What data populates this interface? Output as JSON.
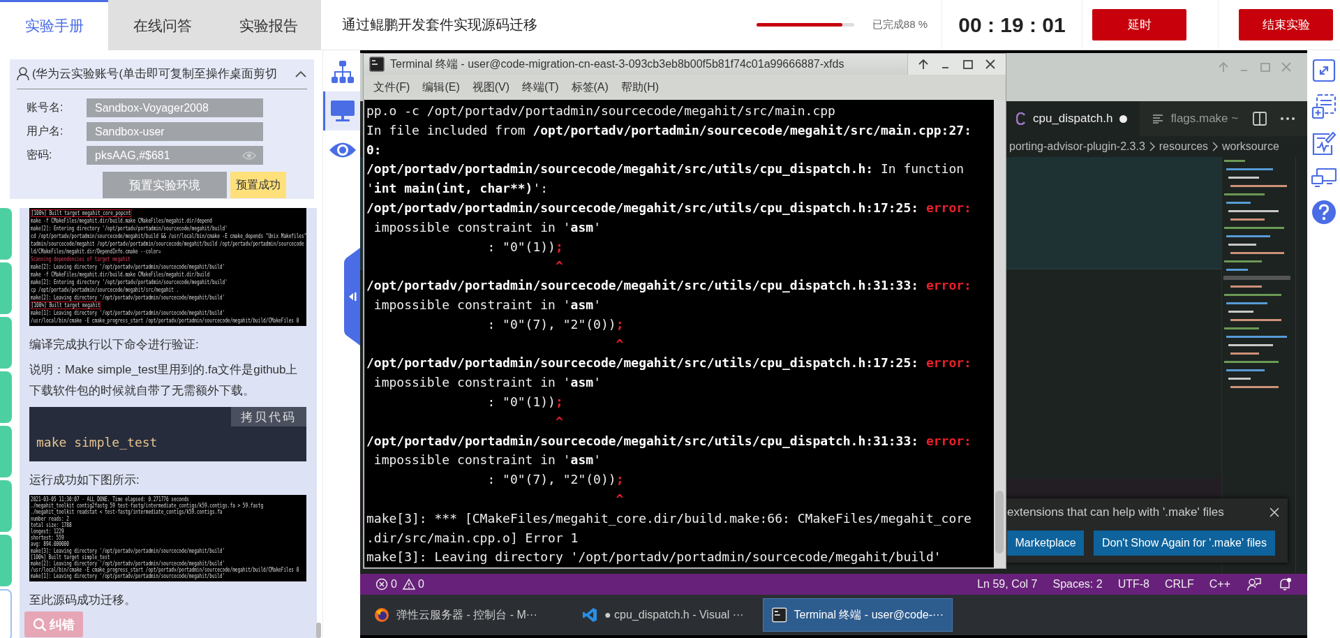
{
  "tabs": [
    {
      "label": "实验手册",
      "selected": true
    },
    {
      "label": "在线问答",
      "selected": false
    },
    {
      "label": "实验报告",
      "selected": false
    }
  ],
  "lab_title": "通过鲲鹏开发套件实现源码迁移",
  "progress": {
    "level": 0.88,
    "label": "已完成88 %"
  },
  "timer": "00 : 19 : 01",
  "buttons": [
    {
      "label": "延时"
    },
    {
      "label": "结束实验"
    }
  ],
  "account": {
    "title": "(华为云实验账号(单击即可复制至操作桌面剪切",
    "expanded": true,
    "fields": [
      {
        "label": "账号名:",
        "value": "Sandbox-Voyager2008",
        "kind": "text"
      },
      {
        "label": "用户名:",
        "value": "Sandbox-user",
        "kind": "text"
      },
      {
        "label": "密码:",
        "value": "pksAAG,#$681",
        "kind": "password"
      }
    ],
    "setup_button": "预置实验环境",
    "status": "预置成功"
  },
  "chapter_markers": [
    {
      "selected": false
    },
    {
      "selected": false
    },
    {
      "selected": false
    },
    {
      "selected": false
    },
    {
      "selected": false
    },
    {
      "selected": false
    },
    {
      "selected": false
    },
    {
      "selected": true
    }
  ],
  "manual": [
    {
      "kind": "screenshot",
      "lines": [
        {
          "text": "[100%] Built target megahit_core_popcnt",
          "kind": "boxed"
        },
        {
          "text": "make -f CMakeFiles/megahit.dir/build.make CMakeFiles/megahit.dir/depend",
          "kind": "plain"
        },
        {
          "text": "make[2]: Entering directory '/opt/portadv/portadmin/sourcecode/megahit/build'",
          "kind": "plain"
        },
        {
          "text": "cd /opt/portadv/portadmin/sourcecode/megahit/build && /usr/local/bin/cmake -E cmake_depends \"Unix Makefiles\"",
          "kind": "plain"
        },
        {
          "text": "tadmin/sourcecode/megahit /opt/portadv/portadmin/sourcecode/megahit/build /opt/portadv/portadmin/sourcecode",
          "kind": "plain"
        },
        {
          "text": "ld/CMakeFiles/megahit.dir/DependInfo.cmake --color=",
          "kind": "plain"
        },
        {
          "text": "Scanning dependencies of target megahit",
          "kind": "alert"
        },
        {
          "text": "make[2]: Leaving directory '/opt/portadv/portadmin/sourcecode/megahit/build'",
          "kind": "plain"
        },
        {
          "text": "make -f CMakeFiles/megahit.dir/build.make CMakeFiles/megahit.dir/build",
          "kind": "plain"
        },
        {
          "text": "make[2]: Entering directory '/opt/portadv/portadmin/sourcecode/megahit/build'",
          "kind": "plain"
        },
        {
          "text": "cp /opt/portadv/portadmin/sourcecode/megahit/src/megahit .",
          "kind": "plain"
        },
        {
          "text": "make[2]: Leaving directory '/opt/portadv/portadmin/sourcecode/megahit/build'",
          "kind": "plain"
        },
        {
          "text": "[100%] Built target megahit",
          "kind": "boxed"
        },
        {
          "text": "make[1]: Leaving directory '/opt/portadv/portadmin/sourcecode/megahit/build'",
          "kind": "plain"
        },
        {
          "text": "/usr/local/bin/cmake -E cmake_progress_start /opt/portadv/portadmin/sourcecode/megahit/build/CMakeFiles 0",
          "kind": "plain"
        }
      ]
    },
    {
      "kind": "paragraph",
      "text": "编译完成执行以下命令进行验证:"
    },
    {
      "kind": "paragraph",
      "text": "说明：Make simple_test里用到的.fa文件是github上下载软件包的时候就自带了无需额外下载。"
    },
    {
      "kind": "code",
      "copy_label": "拷贝代码",
      "code": "make simple_test"
    },
    {
      "kind": "paragraph",
      "text": "运行成功如下图所示:"
    },
    {
      "kind": "screenshot",
      "lines": [
        {
          "text": "2021-03-05 11:30:07 - ALL DONE. Time elapsed: 0.271776 seconds",
          "kind": "plain"
        },
        {
          "text": "./megahit_toolkit contig2fastg 59 test-fastg/intermediate_contigs/k59.contigs.fa > 59.fastg",
          "kind": "plain"
        },
        {
          "text": "./megahit_toolkit readstat < test-fastg/intermediate_contigs/k59.contigs.fa",
          "kind": "plain"
        },
        {
          "text": "number reads: 2",
          "kind": "plain"
        },
        {
          "text": "total size: 1788",
          "kind": "plain"
        },
        {
          "text": "longest: 1229",
          "kind": "plain"
        },
        {
          "text": "shortest: 559",
          "kind": "plain"
        },
        {
          "text": "avg: 894.000000",
          "kind": "plain"
        },
        {
          "text": "make[3]: Leaving directory '/opt/portadv/portadmin/sourcecode/megahit/build'",
          "kind": "plain"
        },
        {
          "text": "[100%] Built target simple_test",
          "kind": "plain"
        },
        {
          "text": "make[2]: Leaving directory '/opt/portadv/portadmin/sourcecode/megahit/build'",
          "kind": "plain"
        },
        {
          "text": "/usr/local/bin/cmake -E cmake_progress_start /opt/portadv/portadmin/sourcecode/megahit/build/CMakeFiles 0",
          "kind": "plain"
        },
        {
          "text": "make[1]: Leaving directory '/opt/portadv/portadmin/sourcecode/megahit/build'",
          "kind": "plain"
        }
      ]
    },
    {
      "kind": "paragraph",
      "text": "至此源码成功迁移。"
    }
  ],
  "report_error_button": "纠错",
  "tool_rail": [
    {
      "kind": "topology",
      "selected": false
    },
    {
      "kind": "desktop",
      "selected": true
    },
    {
      "kind": "preview",
      "selected": false
    }
  ],
  "terminal": {
    "title": "Terminal 终端 - user@code-migration-cn-east-3-093cb3eb8b00f5b81f74c01a99666887-xfds",
    "menu": [
      "文件(F)",
      "编辑(E)",
      "视图(V)",
      "终端(T)",
      "标签(A)",
      "帮助(H)"
    ],
    "lines": [
      [
        {
          "text": "pp.o -c /opt/portadv/portadmin/sourcecode/megahit/src/main.cpp",
          "kind": "plain"
        }
      ],
      [
        {
          "text": "In file included from ",
          "kind": "plain"
        },
        {
          "text": "/opt/portadv/portadmin/sourcecode/megahit/src/main.cpp:27:",
          "kind": "bold"
        }
      ],
      [
        {
          "text": "0:",
          "kind": "bold"
        }
      ],
      [
        {
          "text": "/opt/portadv/portadmin/sourcecode/megahit/src/utils/cpu_dispatch.h:",
          "kind": "bold"
        },
        {
          "text": " In function",
          "kind": "plain"
        }
      ],
      [
        {
          "text": "'",
          "kind": "plain"
        },
        {
          "text": "int main(int, char**)",
          "kind": "bold"
        },
        {
          "text": "':",
          "kind": "plain"
        }
      ],
      [
        {
          "text": "/opt/portadv/portadmin/sourcecode/megahit/src/utils/cpu_dispatch.h:17:25: ",
          "kind": "bold"
        },
        {
          "text": "error:",
          "kind": "error"
        }
      ],
      [
        {
          "text": " impossible constraint in '",
          "kind": "plain"
        },
        {
          "text": "asm",
          "kind": "bold"
        },
        {
          "text": "'",
          "kind": "plain"
        }
      ],
      [
        {
          "text": "                : \"0\"(1))",
          "kind": "plain"
        },
        {
          "text": ";",
          "kind": "error"
        }
      ],
      [
        {
          "text": "                         ^",
          "kind": "error"
        }
      ],
      [
        {
          "text": "/opt/portadv/portadmin/sourcecode/megahit/src/utils/cpu_dispatch.h:31:33: ",
          "kind": "bold"
        },
        {
          "text": "error:",
          "kind": "error"
        }
      ],
      [
        {
          "text": " impossible constraint in '",
          "kind": "plain"
        },
        {
          "text": "asm",
          "kind": "bold"
        },
        {
          "text": "'",
          "kind": "plain"
        }
      ],
      [
        {
          "text": "                : \"0\"(7), \"2\"(0))",
          "kind": "plain"
        },
        {
          "text": ";",
          "kind": "error"
        }
      ],
      [
        {
          "text": "                                 ^",
          "kind": "error"
        }
      ],
      [
        {
          "text": "/opt/portadv/portadmin/sourcecode/megahit/src/utils/cpu_dispatch.h:17:25: ",
          "kind": "bold"
        },
        {
          "text": "error:",
          "kind": "error"
        }
      ],
      [
        {
          "text": " impossible constraint in '",
          "kind": "plain"
        },
        {
          "text": "asm",
          "kind": "bold"
        },
        {
          "text": "'",
          "kind": "plain"
        }
      ],
      [
        {
          "text": "                : \"0\"(1))",
          "kind": "plain"
        },
        {
          "text": ";",
          "kind": "error"
        }
      ],
      [
        {
          "text": "                         ^",
          "kind": "error"
        }
      ],
      [
        {
          "text": "/opt/portadv/portadmin/sourcecode/megahit/src/utils/cpu_dispatch.h:31:33: ",
          "kind": "bold"
        },
        {
          "text": "error:",
          "kind": "error"
        }
      ],
      [
        {
          "text": " impossible constraint in '",
          "kind": "plain"
        },
        {
          "text": "asm",
          "kind": "bold"
        },
        {
          "text": "'",
          "kind": "plain"
        }
      ],
      [
        {
          "text": "                : \"0\"(7), \"2\"(0))",
          "kind": "plain"
        },
        {
          "text": ";",
          "kind": "error"
        }
      ],
      [
        {
          "text": "                                 ^",
          "kind": "error"
        }
      ],
      [
        {
          "text": "make[3]: *** [CMakeFiles/megahit_core.dir/build.make:66: CMakeFiles/megahit_core",
          "kind": "plain"
        }
      ],
      [
        {
          "text": ".dir/src/main.cpp.o] Error 1",
          "kind": "plain"
        }
      ],
      [
        {
          "text": "make[3]: Leaving directory '/opt/portadv/portadmin/sourcecode/megahit/build'",
          "kind": "plain"
        }
      ]
    ]
  },
  "editor": {
    "tabs": [
      {
        "label": "cpu_dispatch.h",
        "selected": true,
        "modified": true
      },
      {
        "label": "flags.make ~",
        "selected": false,
        "modified": false
      }
    ],
    "breadcrumb": [
      "porting-advisor-plugin-2.3.3",
      "resources",
      "worksource"
    ],
    "notification": {
      "message": "extensions that can help with '.make' files",
      "actions": [
        "Marketplace",
        "Don't Show Again for '.make' files"
      ]
    },
    "status_bar": {
      "errors": "0",
      "warnings": "0",
      "items": [
        "Ln 59, Col 7",
        "Spaces: 2",
        "UTF-8",
        "CRLF",
        "C++"
      ]
    }
  },
  "taskbar": [
    {
      "kind": "browser",
      "label": "弹性云服务器 - 控制台 - M···",
      "selected": false
    },
    {
      "kind": "editor",
      "label": "● cpu_dispatch.h - Visual ···",
      "selected": false
    },
    {
      "kind": "terminal",
      "label": "Terminal 终端 - user@code-···",
      "selected": true
    }
  ],
  "side_tools": [
    {
      "kind": "fullscreen"
    },
    {
      "kind": "screenshot"
    },
    {
      "kind": "notes"
    },
    {
      "kind": "display"
    },
    {
      "kind": "help"
    }
  ]
}
